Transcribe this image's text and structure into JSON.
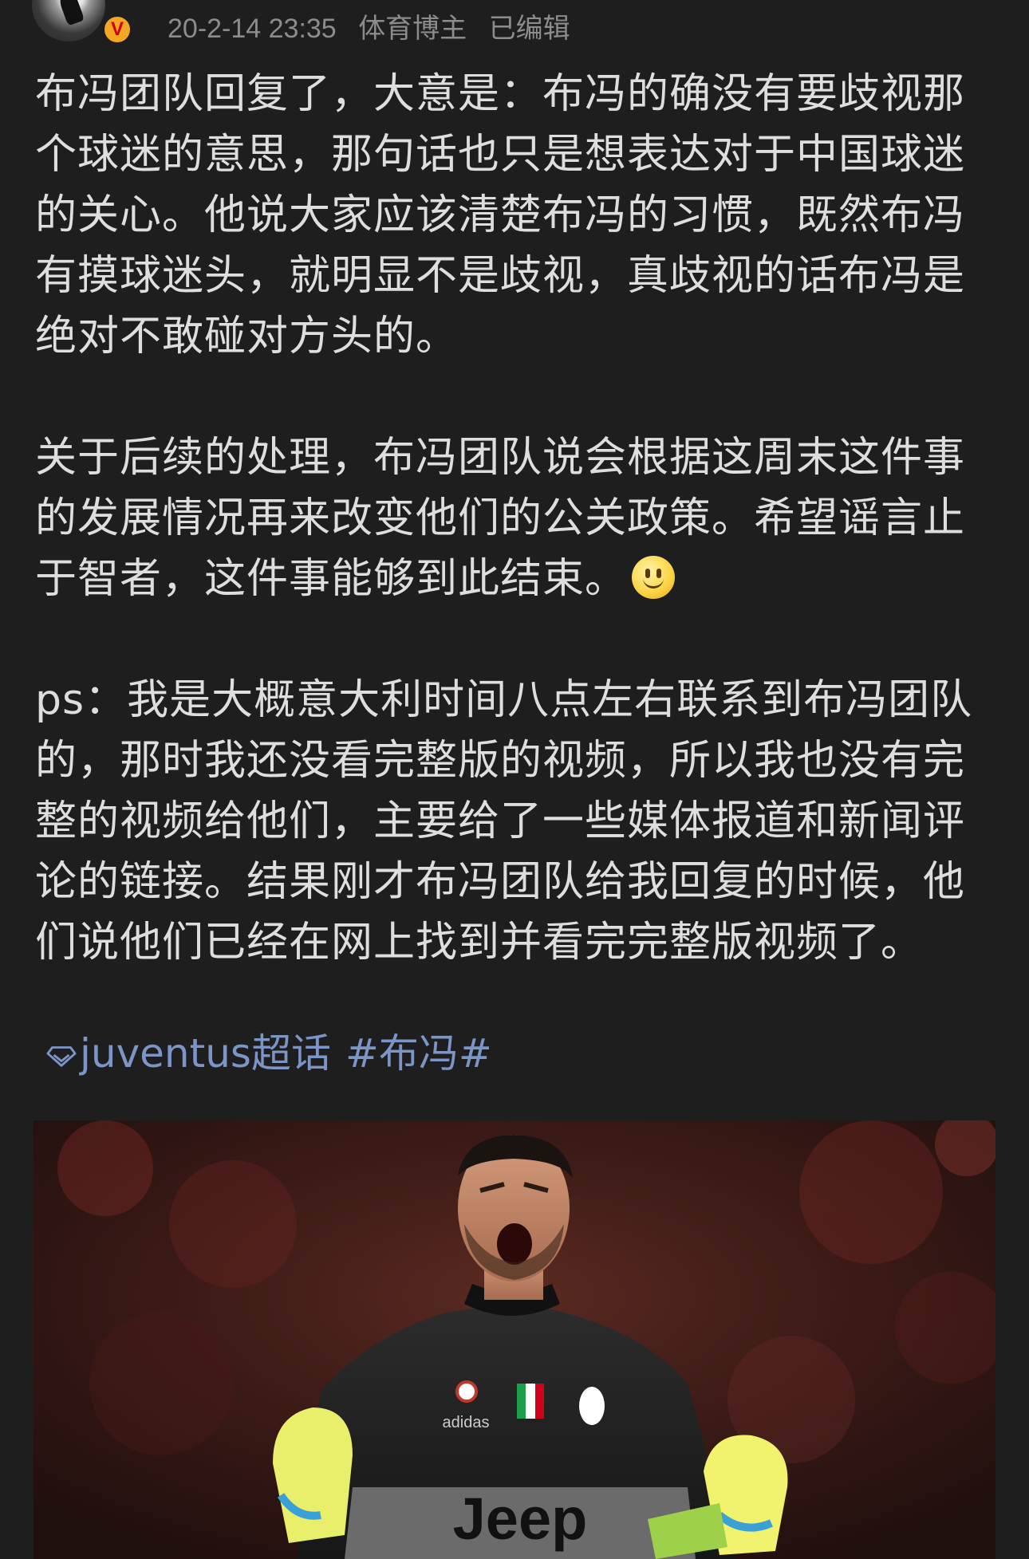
{
  "post": {
    "header": {
      "date": "20-2-14 23:35",
      "source": "体育博主",
      "edited_label": "已编辑",
      "avatar_icon": "user-avatar",
      "verified_badge_text": "V",
      "verified_badge_color": "#f5a623"
    },
    "paragraphs": [
      "布冯团队回复了，大意是：布冯的确没有要歧视那个球迷的意思，那句话也只是想表达对于中国球迷的关心。他说大家应该清楚布冯的习惯，既然布冯有摸球迷头，就明显不是歧视，真歧视的话布冯是绝对不敢碰对方头的。",
      "关于后续的处理，布冯团队说会根据这周末这件事的发展情况再来改变他们的公关政策。希望谣言止于智者，这件事能够到此结束。",
      "ps：我是大概意大利时间八点左右联系到布冯团队的，那时我还没看完整版的视频，所以我也没有完整的视频给他们，主要给了一些媒体报道和新闻评论的链接。结果刚才布冯团队给我回复的时候，他们说他们已经在网上找到并看完完整版视频了。"
    ],
    "emoji": "smiley-face",
    "tags": {
      "super_topic": "juventus超话",
      "hashtag": "#布冯#",
      "super_topic_icon": "diamond-icon",
      "link_color": "#7b95c6"
    },
    "photo": {
      "description_icon": "photo",
      "jersey_text": "Jeep",
      "brand_text": "adidas"
    }
  }
}
